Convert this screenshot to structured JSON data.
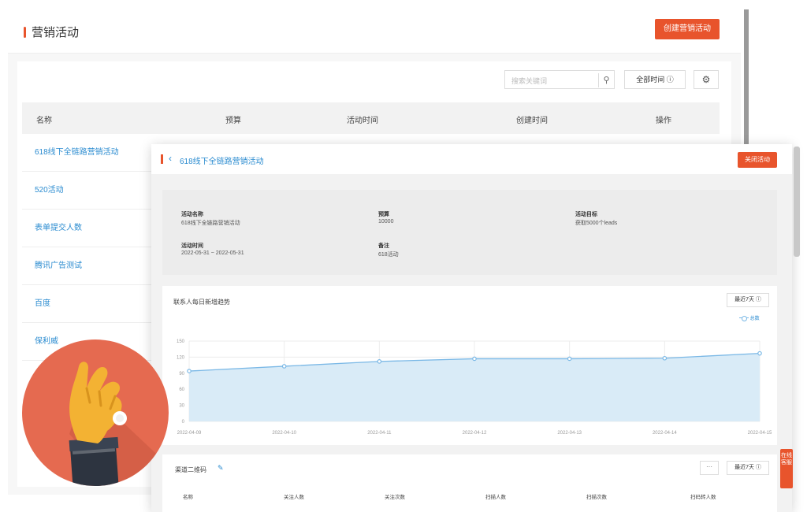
{
  "page": {
    "title": "营销活动",
    "create_button": "创建营销活动"
  },
  "toolbar": {
    "search_placeholder": "搜索关键词",
    "alltime_label": "全部时间 ⓘ",
    "settings_icon": "gear-icon"
  },
  "table": {
    "headers": [
      "名称",
      "预算",
      "活动时间",
      "创建时间",
      "操作"
    ],
    "rows": [
      "618线下全链路营销活动",
      "520活动",
      "表单提交人数",
      "腾讯广告测试",
      "百度",
      "保利威"
    ]
  },
  "detail": {
    "title": "618线下全链路营销活动",
    "close_button": "关闭活动",
    "info": {
      "name_label": "活动名称",
      "name_value": "618线下全链路营销活动",
      "budget_label": "预算",
      "budget_value": "10000",
      "goal_label": "活动目标",
      "goal_value": "获取5000个leads",
      "time_label": "活动时间",
      "time_value": "2022-05-31 ~ 2022-05-31",
      "note_label": "备注",
      "note_value": "618活动"
    },
    "chart_title": "联系人每日新增趋势",
    "range_button": "最近7天 ⓘ",
    "channel_title": "渠道二维码",
    "channel_more": "···",
    "channel_range_button": "最近7天 ⓘ",
    "channel_headers": [
      "名称",
      "关注人数",
      "关注次数",
      "扫描人数",
      "扫描次数",
      "扫码转人数"
    ],
    "side_tab": "在线客服"
  },
  "chart_data": {
    "type": "area",
    "x": [
      "2022-04-09",
      "2022-04-10",
      "2022-04-11",
      "2022-04-12",
      "2022-04-13",
      "2022-04-14",
      "2022-04-15"
    ],
    "series": [
      {
        "name": "总数",
        "values": [
          94,
          103,
          112,
          117,
          117,
          118,
          127
        ]
      }
    ],
    "ylim": [
      0,
      150
    ],
    "yticks": [
      0,
      30,
      60,
      90,
      120,
      150
    ],
    "grid": true,
    "legend": "top-right",
    "color": "#7ab8e6",
    "fill": "#d9ebf7"
  },
  "colors": {
    "accent": "#e8542c",
    "link": "#2a8bd0"
  }
}
